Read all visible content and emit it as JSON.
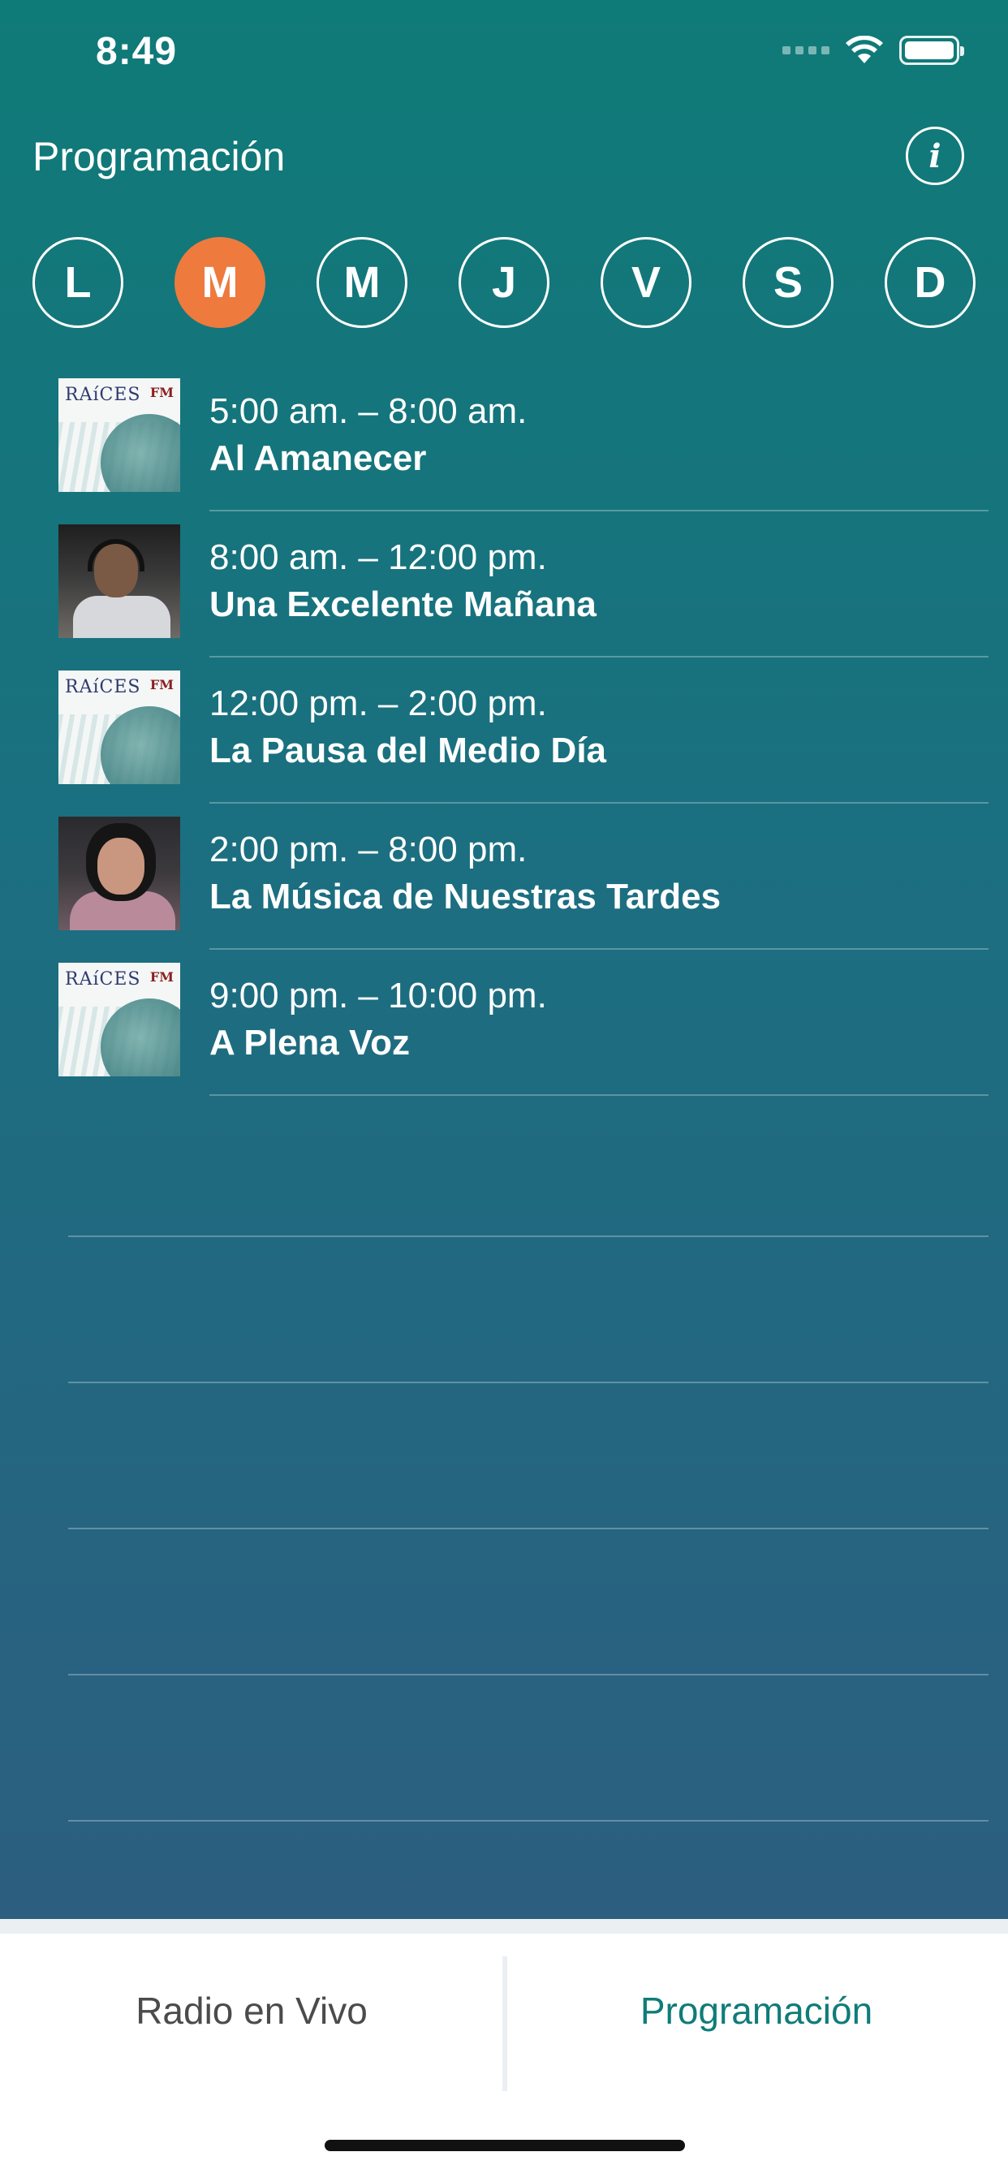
{
  "status_bar": {
    "time": "8:49"
  },
  "header": {
    "title": "Programación",
    "info_label": "i"
  },
  "days": [
    {
      "label": "L",
      "active": false
    },
    {
      "label": "M",
      "active": true
    },
    {
      "label": "M",
      "active": false
    },
    {
      "label": "J",
      "active": false
    },
    {
      "label": "V",
      "active": false
    },
    {
      "label": "S",
      "active": false
    },
    {
      "label": "D",
      "active": false
    }
  ],
  "schedule": [
    {
      "time": "5:00 am. – 8:00 am.",
      "title": "Al Amanecer",
      "thumb": "raices-logo"
    },
    {
      "time": "8:00 am. – 12:00 pm.",
      "title": "Una Excelente Mañana",
      "thumb": "host-photo-man"
    },
    {
      "time": "12:00 pm. – 2:00 pm.",
      "title": "La Pausa del Medio Día",
      "thumb": "raices-logo"
    },
    {
      "time": "2:00 pm. – 8:00 pm.",
      "title": "La Música de Nuestras Tardes",
      "thumb": "host-photo-woman"
    },
    {
      "time": "9:00 pm. – 10:00 pm.",
      "title": "A Plena Voz",
      "thumb": "raices-logo"
    }
  ],
  "raices_logo": {
    "name": "RAíCES",
    "fm": "FM"
  },
  "tabbar": {
    "live_label": "Radio en Vivo",
    "schedule_label": "Programación",
    "active": "schedule"
  },
  "colors": {
    "accent": "#ee7a3e",
    "tab_active": "#0f7c78",
    "bg_top": "#0f7b78",
    "bg_bottom": "#2c5e80"
  }
}
